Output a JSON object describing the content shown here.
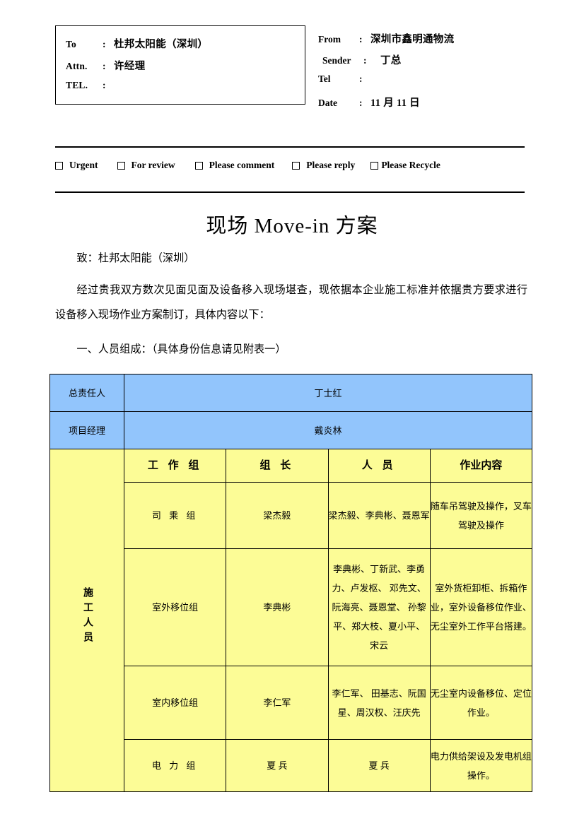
{
  "fax_header": {
    "to_box": [
      {
        "label": "To",
        "colon": ":",
        "value": "杜邦太阳能（深圳）"
      },
      {
        "label": "Attn.",
        "colon": ":",
        "value": "许经理"
      },
      {
        "label": "TEL.",
        "colon": ":",
        "value": ""
      }
    ],
    "from_box": [
      {
        "label": "From",
        "colon": ":",
        "value": "深圳市鑫明通物流"
      },
      {
        "label": "Sender",
        "colon": ":",
        "value": "丁总"
      },
      {
        "label": "Tel",
        "colon": ":",
        "value": ""
      },
      {
        "label": "Date",
        "colon": ":",
        "value": "11 月 11 日"
      }
    ]
  },
  "checkboxes": [
    {
      "label": "Urgent",
      "checked": false
    },
    {
      "label": "For review",
      "checked": false
    },
    {
      "label": "Please comment",
      "checked": false
    },
    {
      "label": "Please reply",
      "checked": false
    },
    {
      "label": "Please Recycle",
      "checked": false
    }
  ],
  "document": {
    "title": "现场 Move-in 方案",
    "salutation": "致：杜邦太阳能（深圳）",
    "paragraph": "经过贵我双方数次见面见面及设备移入现场堪查，现依据本企业施工标准并依据贵方要求进行设备移入现场作业方案制订，具体内容以下：",
    "section_heading": "一、人员组成：（具体身份信息请见附表一）"
  },
  "crew_table": {
    "colors": {
      "blue": "#92c5fc",
      "yellow": "#fcfc96",
      "border": "#000000"
    },
    "blue_rows": [
      {
        "role": "总责任人",
        "name": "丁士红"
      },
      {
        "role": "项目经理",
        "name": "戴炎林"
      }
    ],
    "staff_label": "施工人员",
    "headers": {
      "group": "工 作 组",
      "leader": "组  长",
      "members": "人  员",
      "duty": "作业内容"
    },
    "rows": [
      {
        "group": "司 乘 组",
        "leader": "梁杰毅",
        "members": "梁杰毅、李典彬、聂恩军",
        "duty": "随车吊驾驶及操作，叉车驾驶及操作"
      },
      {
        "group": "室外移位组",
        "leader": "李典彬",
        "members": "李典彬、丁新武、李勇力、卢发枢、 邓先文、阮海亮、聂恩堂、 孙黎平、郑大枝、夏小平、 宋云",
        "duty": "室外货柜卸柜、拆箱作业，室外设备移位作业、无尘室外工作平台搭建。"
      },
      {
        "group": "室内移位组",
        "leader": "李仁军",
        "members": "李仁军、 田基志、阮国星、周汉权、汪庆先",
        "duty": "无尘室内设备移位、定位作业。"
      },
      {
        "group": "电 力 组",
        "leader": "夏  兵",
        "members": "夏  兵",
        "duty": "电力供给架设及发电机组操作。"
      }
    ]
  }
}
